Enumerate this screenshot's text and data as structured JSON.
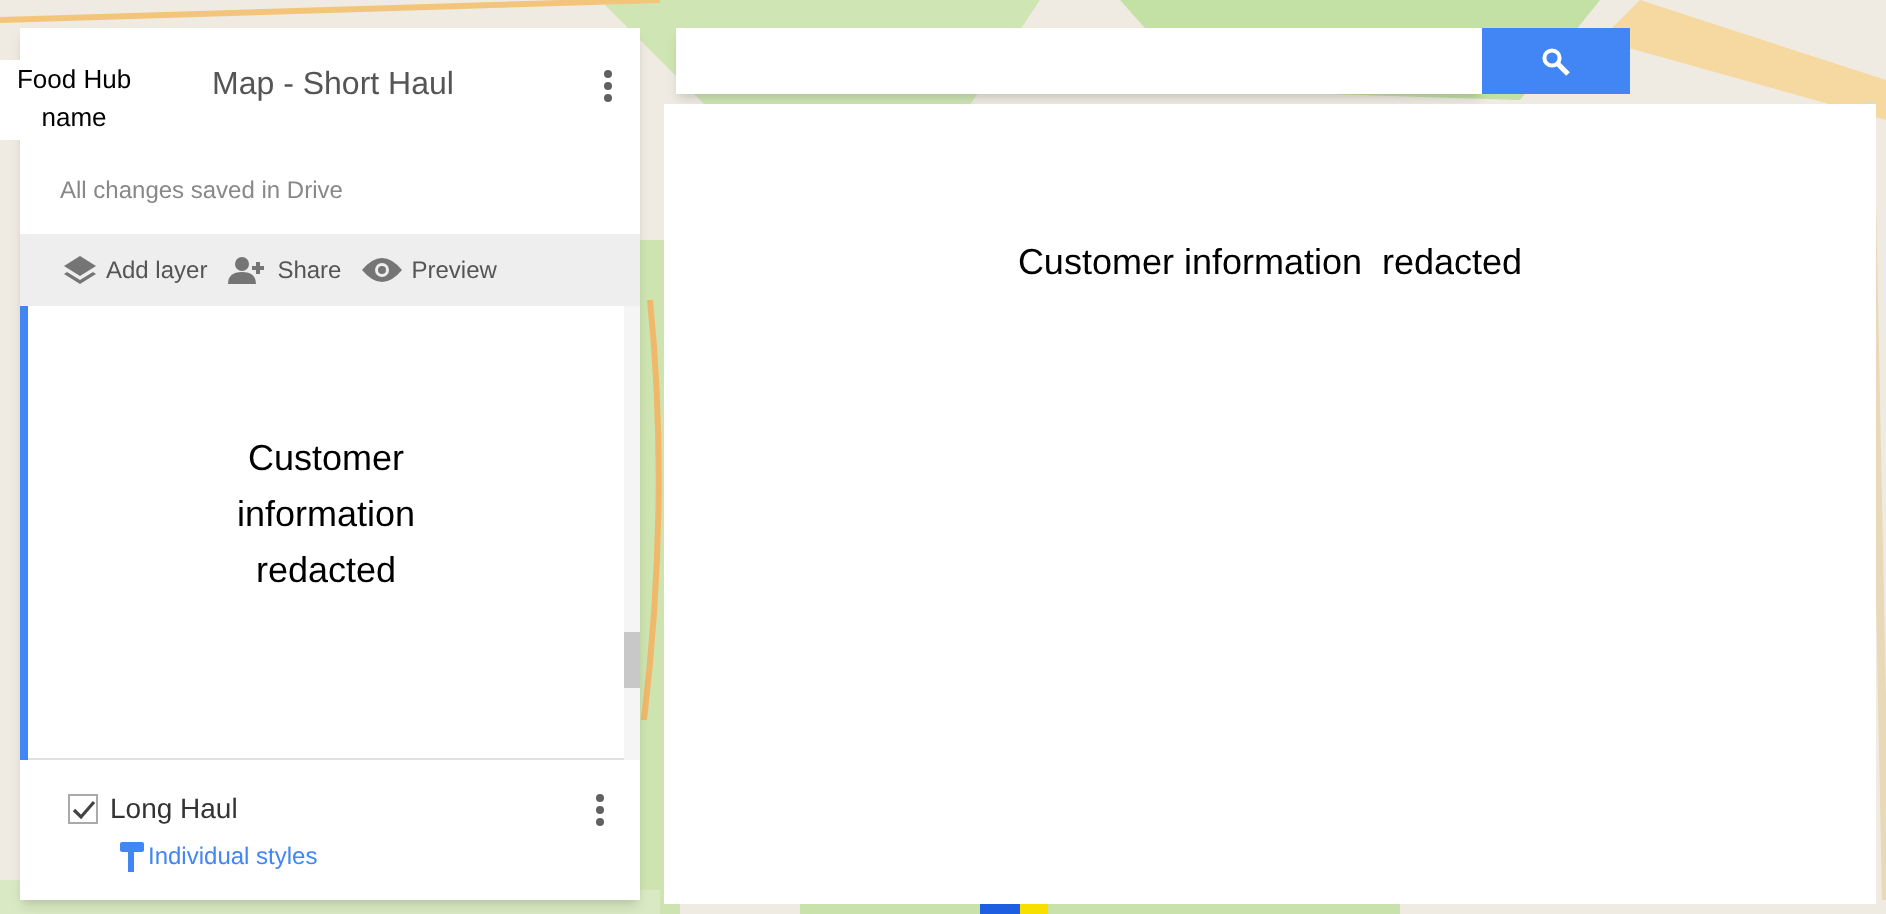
{
  "panel": {
    "annotation": "Food Hub name",
    "title": "Map - Short Haul",
    "status": "All changes saved in Drive",
    "toolbar": [
      {
        "kind": "add-layer",
        "label": "Add layer"
      },
      {
        "kind": "share",
        "label": "Share"
      },
      {
        "kind": "preview",
        "label": "Preview"
      }
    ],
    "redaction": "Customer information redacted",
    "layers": [
      {
        "name": "Long Haul",
        "checked": true,
        "style": "Individual styles"
      }
    ]
  },
  "redaction": "Customer information  redacted"
}
